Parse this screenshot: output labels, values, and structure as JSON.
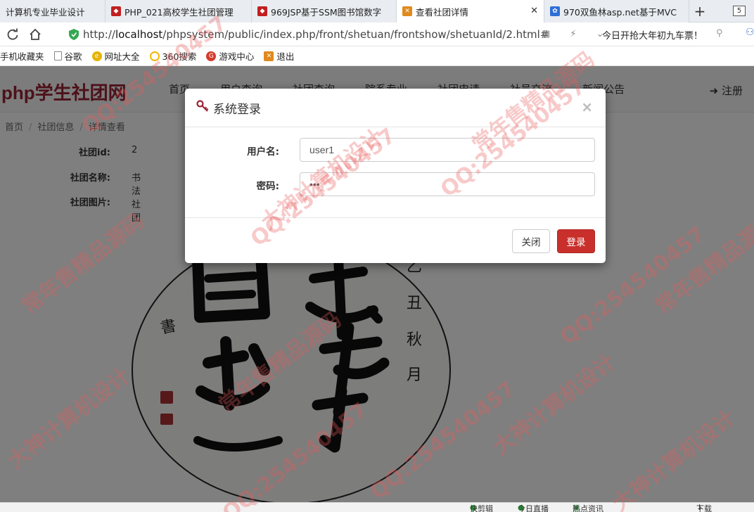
{
  "tabs": [
    {
      "title": "计算机专业毕业设计",
      "active": false,
      "favicon_color": "#2c6fd6"
    },
    {
      "title": "PHP_021高校学生社团管理",
      "active": false,
      "favicon_color": "#c21f1f"
    },
    {
      "title": "969JSP基于SSM图书馆数字",
      "active": false,
      "favicon_color": "#c21f1f"
    },
    {
      "title": "查看社团详情",
      "active": true,
      "favicon_color": "#e08a1e"
    },
    {
      "title": "970双鱼林asp.net基于MVC",
      "active": false,
      "favicon_color": "#2c6fd6"
    }
  ],
  "tab_count": "5",
  "address": {
    "url_prefix": "http://",
    "url_host": "localhost",
    "url_path": "/phpsystem/public/index.php/front/shetuan/frontshow/shetuanId/2.html#",
    "promo_text": "今日开抢大年初九车票！"
  },
  "bookmarks": [
    "手机收藏夹",
    "谷歌",
    "网址大全",
    "360搜索",
    "游戏中心",
    "退出"
  ],
  "site": {
    "logo": "php学生社团网",
    "menu": [
      "首页",
      "用户查询",
      "社团查询",
      "院系专业",
      "社团申请",
      "社员交流",
      "新闻公告"
    ],
    "register": "注册",
    "breadcrumb": [
      "首页",
      "社团信息",
      "详情查看"
    ],
    "details": [
      {
        "label": "社团id:",
        "value": "2"
      },
      {
        "label": "社团名称:",
        "value": "书法社团"
      },
      {
        "label": "社团图片:",
        "value": ""
      }
    ]
  },
  "modal": {
    "title": "系统登录",
    "username_label": "用户名:",
    "username_value": "user1",
    "password_label": "密码:",
    "password_value": "•••",
    "close_button": "关闭",
    "login_button": "登录"
  },
  "statusbar": [
    "快剪辑",
    "今日直播",
    "热点资讯",
    "下载"
  ],
  "watermark_texts": [
    "QQ:254540457",
    "常年售精品源码",
    "大神计算机设计"
  ]
}
